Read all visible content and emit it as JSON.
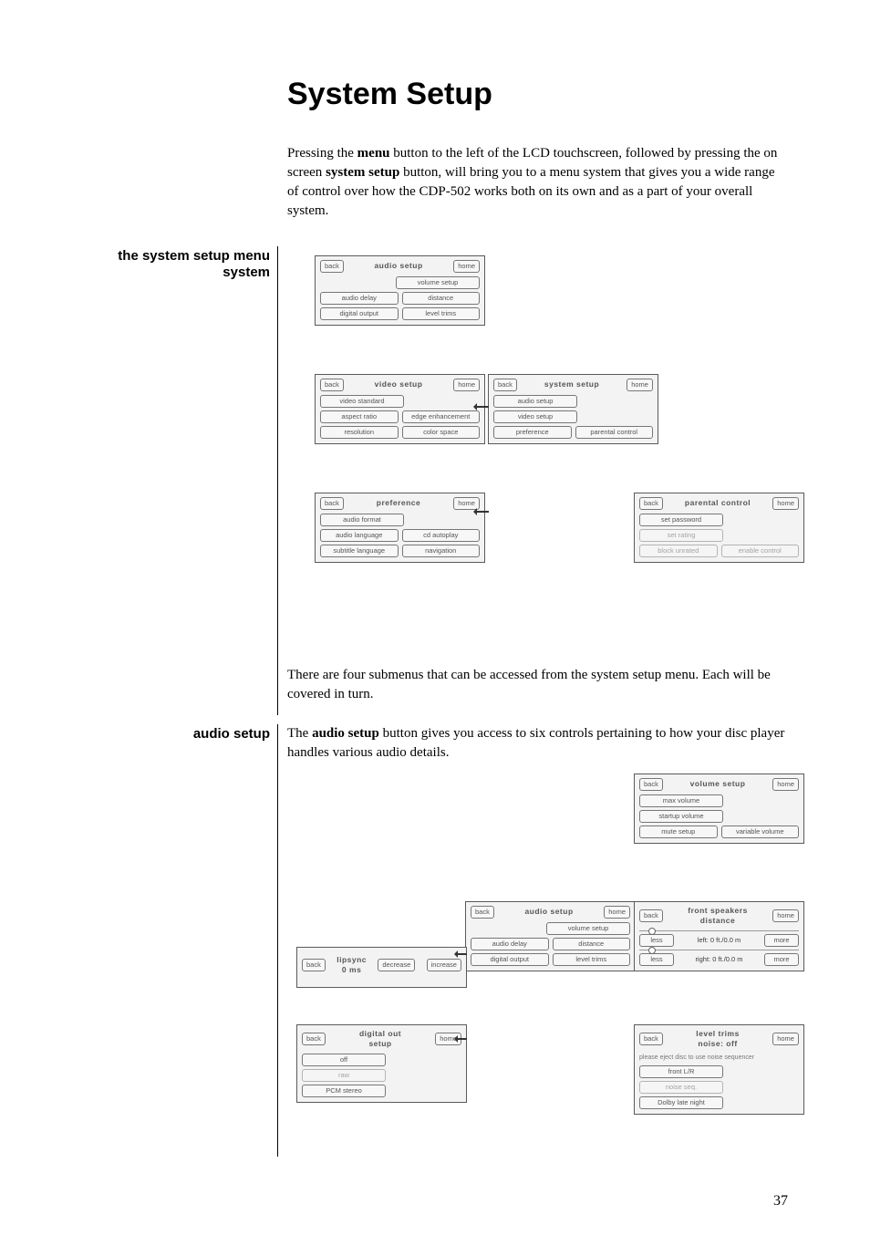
{
  "page_number": "37",
  "title": "System Setup",
  "intro_p1_a": "Pressing the ",
  "intro_p1_b": " button to the left of the LCD touchscreen, followed by pressing the on screen ",
  "intro_p1_c": " button, will bring you to a menu system that gives you a wide range of control over how the CDP-502 works both on its own and as a part of your overall system.",
  "intro_bold_menu": "menu",
  "intro_bold_systemsetup": "system setup",
  "section1_label": "the system setup menu system",
  "mid_para": "There are four submenus that can be accessed from the system setup menu. Each will be covered in turn.",
  "section2_label": "audio setup",
  "audio_p_a": "The ",
  "audio_p_b": " button gives you access to six controls pertaining to how your disc player handles various audio details.",
  "audio_bold": "audio setup",
  "btn": {
    "back": "back",
    "home": "home",
    "less": "less",
    "more": "more",
    "decrease": "decrease",
    "increase": "increase"
  },
  "panels": {
    "audio_setup": {
      "title": "audio  setup",
      "volume_setup": "volume setup",
      "audio_delay": "audio delay",
      "distance": "distance",
      "digital_output": "digital output",
      "level_trims": "level trims"
    },
    "video_setup": {
      "title": "video  setup",
      "video_standard": "video standard",
      "aspect_ratio": "aspect ratio",
      "edge_enhancement": "edge enhancement",
      "resolution": "resolution",
      "color_space": "color space"
    },
    "system_setup": {
      "title": "system  setup",
      "audio_setup": "audio setup",
      "video_setup": "video setup",
      "preference": "preference",
      "parental_control": "parental control"
    },
    "preference": {
      "title": "preference",
      "audio_format": "audio format",
      "audio_language": "audio language",
      "cd_autoplay": "cd autoplay",
      "subtitle_language": "subtitle language",
      "navigation": "navigation"
    },
    "parental_control": {
      "title": "parental  control",
      "set_password": "set password",
      "set_rating": "set rating",
      "block_unrated": "block unrated",
      "enable_control": "enable control"
    },
    "volume_setup": {
      "title": "volume  setup",
      "max_volume": "max volume",
      "startup_volume": "startup volume",
      "mute_setup": "mute setup",
      "variable_volume": "variable volume"
    },
    "front_speakers": {
      "title": "front speakers",
      "subtitle": "distance",
      "left_val": "left: 0 ft./0.0 m",
      "right_val": "right: 0 ft./0.0 m"
    },
    "lipsync": {
      "title": "lipsync",
      "subtitle": "0 ms"
    },
    "digital_out": {
      "title": "digital out",
      "subtitle": "setup",
      "off": "off",
      "raw": "raw",
      "pcm_stereo": "PCM stereo"
    },
    "level_trims": {
      "title": "level trims",
      "subtitle": "noise: off",
      "note": "please eject disc to use noise sequencer",
      "front_lr": "front L/R",
      "noise_seq": "noise seq.",
      "dolby_late": "Dolby late night"
    }
  }
}
